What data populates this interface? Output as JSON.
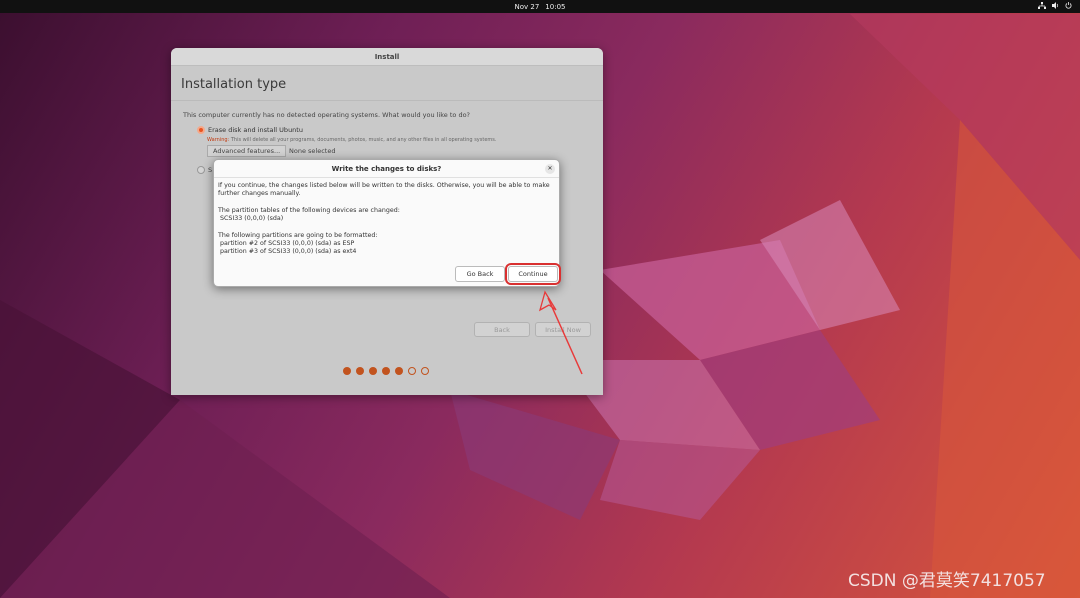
{
  "topbar": {
    "date": "Nov 27",
    "time": "10:05",
    "tray_icons": [
      "network-icon",
      "volume-icon",
      "power-icon"
    ]
  },
  "installer": {
    "window_title": "Install",
    "heading": "Installation type",
    "question": "This computer currently has no detected operating systems. What would you like to do?",
    "option_erase": "Erase disk and install Ubuntu",
    "warning_label": "Warning:",
    "warning_text": "This will delete all your programs, documents, photos, music, and any other files in all operating systems.",
    "advanced_label": "Advanced features...",
    "advanced_value": "None selected",
    "option_other_prefix": "S",
    "back_label": "Back",
    "install_label": "Install Now",
    "progress": {
      "total": 7,
      "completed": 5
    }
  },
  "dialog": {
    "title": "Write the changes to disks?",
    "intro": "If you continue, the changes listed below will be written to the disks. Otherwise, you will be able to make further changes manually.",
    "tables_heading": "The partition tables of the following devices are changed:",
    "tables_items": [
      "SCSI33 (0,0,0) (sda)"
    ],
    "format_heading": "The following partitions are going to be formatted:",
    "format_items": [
      "partition #2 of SCSI33 (0,0,0) (sda) as ESP",
      "partition #3 of SCSI33 (0,0,0) (sda) as ext4"
    ],
    "go_back_label": "Go Back",
    "continue_label": "Continue"
  },
  "watermark": "CSDN @君莫笑7417057",
  "colors": {
    "accent": "#e95420",
    "highlight": "#d93030"
  }
}
